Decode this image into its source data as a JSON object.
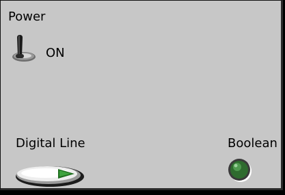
{
  "controls": {
    "power": {
      "label": "Power",
      "state_text": "ON",
      "state": true
    },
    "digital_line": {
      "label": "Digital Line",
      "state": true
    },
    "boolean": {
      "label": "Boolean",
      "state": true
    }
  },
  "colors": {
    "panel_background": "#c7c7c7",
    "led_on": "#2e6b2e",
    "button_indicator": "#2a8a2a"
  }
}
